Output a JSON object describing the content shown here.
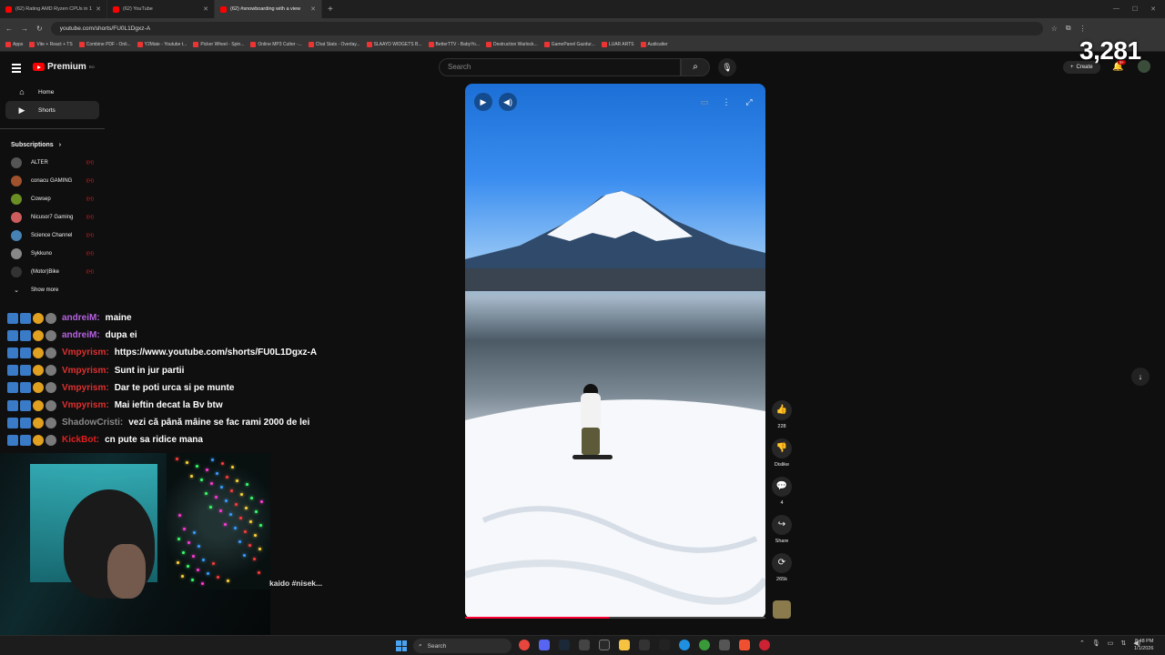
{
  "browser": {
    "tabs": [
      {
        "title": "(62) Rating AMD Ryzen CPUs in 1"
      },
      {
        "title": "(62) YouTube"
      },
      {
        "title": "(62) #snowboarding with a view"
      }
    ],
    "url": "youtube.com/shorts/FU0L1Dgxz-A",
    "bookmarks": [
      "Apps",
      "Vite + React + TS",
      "Combine PDF - Onli...",
      "Y2Mate - Youtube t...",
      "Picker Wheel - Spin...",
      "Online MP3 Cutter -...",
      "Chat Stats - Overlay...",
      "SLAAYD WIDGETS B...",
      "BetterTTV - BabyYo...",
      "Destruction Warlock...",
      "GamePanel Gazdur...",
      "LUAR ARTS",
      "Audicalter"
    ]
  },
  "header": {
    "logo_text": "Premium",
    "logo_region": "RO",
    "search_placeholder": "Search",
    "create_label": "Create",
    "notif_count": "9+"
  },
  "stream_counter": "3,281",
  "sidebar": {
    "items": [
      {
        "label": "Home",
        "icon": "home-icon"
      },
      {
        "label": "Shorts",
        "icon": "shorts-icon"
      }
    ],
    "subscriptions_title": "Subscriptions",
    "subscriptions": [
      {
        "name": "ALTER",
        "color": "#555"
      },
      {
        "name": "conacu GAMING",
        "color": "#a0522d"
      },
      {
        "name": "Cowsep",
        "color": "#6b8e23"
      },
      {
        "name": "Nicusor7 Gaming",
        "color": "#cd5c5c"
      },
      {
        "name": "Science Channel",
        "color": "#4682b4"
      },
      {
        "name": "Sykkuno",
        "color": "#888"
      },
      {
        "name": "(Motor)Bike",
        "color": "#333"
      }
    ],
    "show_more": "Show more"
  },
  "chat": [
    {
      "name": "andreiM:",
      "text": "maine",
      "style": "purple"
    },
    {
      "name": "andreiM:",
      "text": "dupa ei",
      "style": "purple"
    },
    {
      "name": "Vmpyrism:",
      "text": "https://www.youtube.com/shorts/FU0L1Dgxz-A",
      "style": "red"
    },
    {
      "name": "Vmpyrism:",
      "text": "Sunt in jur partii",
      "style": "red"
    },
    {
      "name": "Vmpyrism:",
      "text": "Dar te poti urca si pe munte",
      "style": "red"
    },
    {
      "name": "Vmpyrism:",
      "text": "Mai ieftin decat la Bv btw",
      "style": "red"
    },
    {
      "name": "ShadowCristi:",
      "text": "vezi că până mâine se fac rami 2000 de lei",
      "style": "gray"
    },
    {
      "name": "KickBot:",
      "text": "cn pute sa ridice mana",
      "style": "kick"
    }
  ],
  "video": {
    "caption_fragment": "kaido #nisek...",
    "progress": 0.48
  },
  "actions": [
    {
      "icon": "like-icon",
      "label": "228"
    },
    {
      "icon": "dislike-icon",
      "label": "Dislike"
    },
    {
      "icon": "comment-icon",
      "label": "4"
    },
    {
      "icon": "share-icon",
      "label": "Share"
    },
    {
      "icon": "remix-icon",
      "label": "265k"
    }
  ],
  "taskbar": {
    "search_label": "Search",
    "time": "8:48 PM",
    "date": "1/1/2026"
  }
}
